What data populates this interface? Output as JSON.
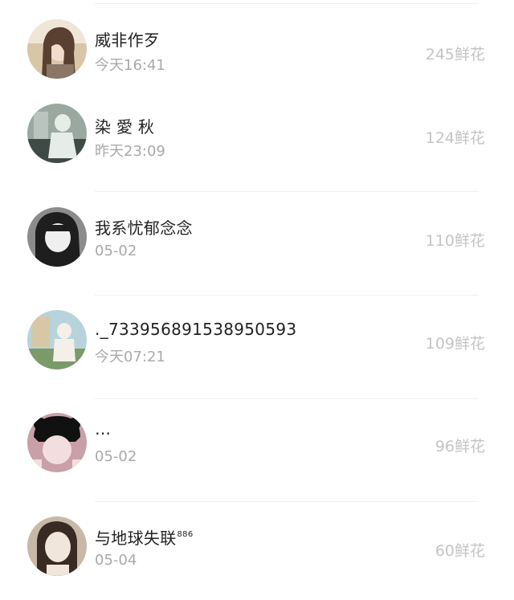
{
  "list": {
    "items": [
      {
        "name": "威非作歹",
        "badge": "",
        "time": "今天16:41",
        "flowers": "245鲜花",
        "avatar_colors": [
          "#d9c6a8",
          "#5a4030",
          "#f0e6d8"
        ]
      },
      {
        "name": "染 愛 秋",
        "badge": "",
        "time": "昨天23:09",
        "flowers": "124鲜花",
        "avatar_colors": [
          "#9aa8a0",
          "#3f4a46",
          "#e6ece8"
        ]
      },
      {
        "name": "我系忧郁念念",
        "badge": "",
        "time": "05-02",
        "flowers": "110鲜花",
        "avatar_colors": [
          "#8c8c8c",
          "#1e1e1e",
          "#efefef"
        ]
      },
      {
        "name": "._733956891538950593",
        "badge": "",
        "time": "今天07:21",
        "flowers": "109鲜花",
        "avatar_colors": [
          "#b7d3dc",
          "#7a9a6a",
          "#f4efe8"
        ]
      },
      {
        "name": "…",
        "badge": "",
        "time": "05-02",
        "flowers": "96鲜花",
        "avatar_colors": [
          "#c9a0a8",
          "#111111",
          "#f3dede"
        ]
      },
      {
        "name": "与地球失联",
        "badge": "886",
        "time": "05-04",
        "flowers": "60鲜花",
        "avatar_colors": [
          "#c7b8a8",
          "#3a2a24",
          "#f1e6dc"
        ]
      }
    ]
  }
}
